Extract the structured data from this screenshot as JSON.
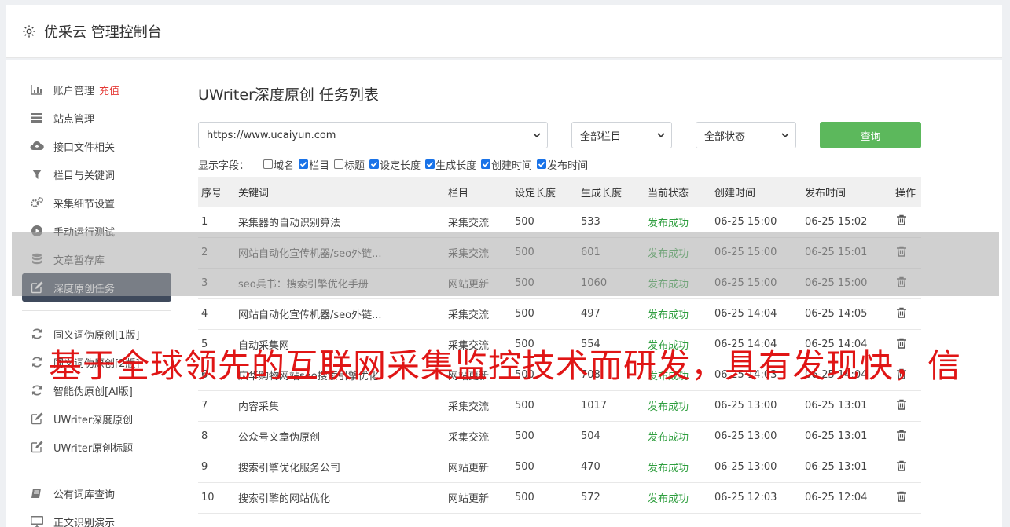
{
  "header": {
    "title": "优采云 管理控制台",
    "icon": "gear-icon"
  },
  "sidebar": {
    "group1": [
      {
        "label": "账户管理",
        "extra": "充值",
        "icon": "bar-chart-icon"
      },
      {
        "label": "站点管理",
        "icon": "server-icon"
      },
      {
        "label": "接口文件相关",
        "icon": "cloud-upload-icon"
      },
      {
        "label": "栏目与关键词",
        "icon": "filter-icon"
      },
      {
        "label": "采集细节设置",
        "icon": "cogs-icon"
      },
      {
        "label": "手动运行测试",
        "icon": "play-circle-icon"
      },
      {
        "label": "文章暂存库",
        "icon": "database-icon"
      },
      {
        "label": "深度原创任务",
        "icon": "edit-icon",
        "active": true
      }
    ],
    "group2": [
      {
        "label": "同义词伪原创[1版]",
        "icon": "refresh-icon"
      },
      {
        "label": "同义词伪原创[2版]",
        "icon": "refresh-icon"
      },
      {
        "label": "智能伪原创[AI版]",
        "icon": "refresh-icon"
      },
      {
        "label": "UWriter深度原创",
        "icon": "edit-icon"
      },
      {
        "label": "UWriter原创标题",
        "icon": "edit-icon"
      }
    ],
    "group3": [
      {
        "label": "公有词库查询",
        "icon": "book-icon"
      },
      {
        "label": "正文识别演示",
        "icon": "monitor-icon"
      }
    ]
  },
  "main": {
    "title": "UWriter深度原创 任务列表",
    "site_select": "https://www.ucaiyun.com",
    "column_select": "全部栏目",
    "status_select": "全部状态",
    "query_label": "查询",
    "fields_label": "显示字段：",
    "fields": [
      {
        "label": "域名",
        "checked": false
      },
      {
        "label": "栏目",
        "checked": true
      },
      {
        "label": "标题",
        "checked": false
      },
      {
        "label": "设定长度",
        "checked": true
      },
      {
        "label": "生成长度",
        "checked": true
      },
      {
        "label": "创建时间",
        "checked": true
      },
      {
        "label": "发布时间",
        "checked": true
      }
    ],
    "table": {
      "headers": [
        "序号",
        "关键词",
        "栏目",
        "设定长度",
        "生成长度",
        "当前状态",
        "创建时间",
        "发布时间",
        "操作"
      ],
      "rows": [
        [
          "1",
          "采集器的自动识别算法",
          "采集交流",
          "500",
          "533",
          "发布成功",
          "06-25 15:00",
          "06-25 15:02"
        ],
        [
          "2",
          "网站自动化宣传机器/seo外链...",
          "采集交流",
          "500",
          "601",
          "发布成功",
          "06-25 15:00",
          "06-25 15:01"
        ],
        [
          "3",
          "seo兵书：搜索引擎优化手册",
          "网站更新",
          "500",
          "1060",
          "发布成功",
          "06-25 15:00",
          "06-25 15:00"
        ],
        [
          "4",
          "网站自动化宣传机器/seo外链...",
          "采集交流",
          "500",
          "497",
          "发布成功",
          "06-25 14:04",
          "06-25 14:05"
        ],
        [
          "5",
          "自动采集网",
          "采集交流",
          "500",
          "554",
          "发布成功",
          "06-25 14:04",
          "06-25 14:04"
        ],
        [
          "6",
          "庆华购物网站seo搜索引擎优化",
          "网站更新",
          "500",
          "708",
          "发布成功",
          "06-25 14:03",
          "06-25 14:04"
        ],
        [
          "7",
          "内容采集",
          "采集交流",
          "500",
          "1017",
          "发布成功",
          "06-25 13:00",
          "06-25 13:01"
        ],
        [
          "8",
          "公众号文章伪原创",
          "采集交流",
          "500",
          "504",
          "发布成功",
          "06-25 13:00",
          "06-25 13:01"
        ],
        [
          "9",
          "搜索引擎优化服务公司",
          "网站更新",
          "500",
          "470",
          "发布成功",
          "06-25 13:00",
          "06-25 13:01"
        ],
        [
          "10",
          "搜索引擎的网站优化",
          "网站更新",
          "500",
          "572",
          "发布成功",
          "06-25 12:03",
          "06-25 12:04"
        ]
      ]
    }
  },
  "watermark": "基于全球领先的互联网采集监控技术而研发，具有发现快，信",
  "colors": {
    "accent_green": "#5cb85c",
    "success_text": "#2e9e3e",
    "active_nav": "#3f4a5c",
    "recharge_red": "#e53935",
    "watermark_red": "#e01515"
  }
}
